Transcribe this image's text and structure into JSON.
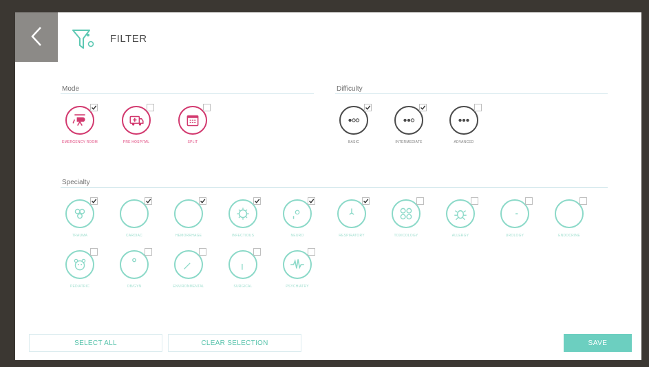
{
  "header": {
    "title": "FILTER",
    "back": "back-arrow-icon",
    "filter": "filter-funnel-icon"
  },
  "colors": {
    "mode": "#d2386e",
    "difficulty": "#4a4a4a",
    "specialty": "#8bd9c8",
    "save": "#6ccfc0",
    "back": "#8c8a87"
  },
  "sections": {
    "mode": {
      "label": "Mode",
      "items": [
        {
          "label": "EMERGENCY ROOM",
          "icon": "helicopter-icon",
          "checked": true
        },
        {
          "label": "PRE HOSPITAL",
          "icon": "ambulance-icon",
          "checked": false
        },
        {
          "label": "SPLIT",
          "icon": "calendar-icon",
          "checked": false
        }
      ]
    },
    "difficulty": {
      "label": "Difficulty",
      "items": [
        {
          "label": "BASIC",
          "icon": "difficulty-one-dot-icon",
          "checked": true
        },
        {
          "label": "INTERMEDIATE",
          "icon": "difficulty-two-dots-icon",
          "checked": true
        },
        {
          "label": "ADVANCED",
          "icon": "difficulty-three-dots-icon",
          "checked": false
        }
      ]
    },
    "specialty": {
      "label": "Specialty",
      "items": [
        {
          "label": "TRAUMA",
          "icon": "bones-icon",
          "checked": true
        },
        {
          "label": "CARDIAC",
          "icon": "heart-icon",
          "checked": true
        },
        {
          "label": "HEMORRHAGE",
          "icon": "blood-drop-icon",
          "checked": true
        },
        {
          "label": "INFECTIOUS",
          "icon": "virus-icon",
          "checked": true
        },
        {
          "label": "NEURO",
          "icon": "brain-head-icon",
          "checked": true
        },
        {
          "label": "RESPIRATORY",
          "icon": "lungs-icon",
          "checked": true
        },
        {
          "label": "TOXICOLOGY",
          "icon": "molecule-icon",
          "checked": false
        },
        {
          "label": "ALLERGY",
          "icon": "bug-icon",
          "checked": false
        },
        {
          "label": "UROLOGY",
          "icon": "kidney-icon",
          "checked": false
        },
        {
          "label": "ENDOCRINE",
          "icon": "thyroid-icon",
          "checked": false
        },
        {
          "label": "PEDIATRIC",
          "icon": "baby-face-icon",
          "checked": false
        },
        {
          "label": "OB/GYN",
          "icon": "pregnancy-icon",
          "checked": false
        },
        {
          "label": "ENVIRONMENTAL",
          "icon": "leaf-icon",
          "checked": false
        },
        {
          "label": "SURGICAL",
          "icon": "scalpel-icon",
          "checked": false
        },
        {
          "label": "PSYCHIATRY",
          "icon": "wave-pulse-icon",
          "checked": false
        }
      ]
    }
  },
  "footer": {
    "select_all": "SELECT ALL",
    "clear_selection": "CLEAR SELECTION",
    "save": "SAVE"
  }
}
